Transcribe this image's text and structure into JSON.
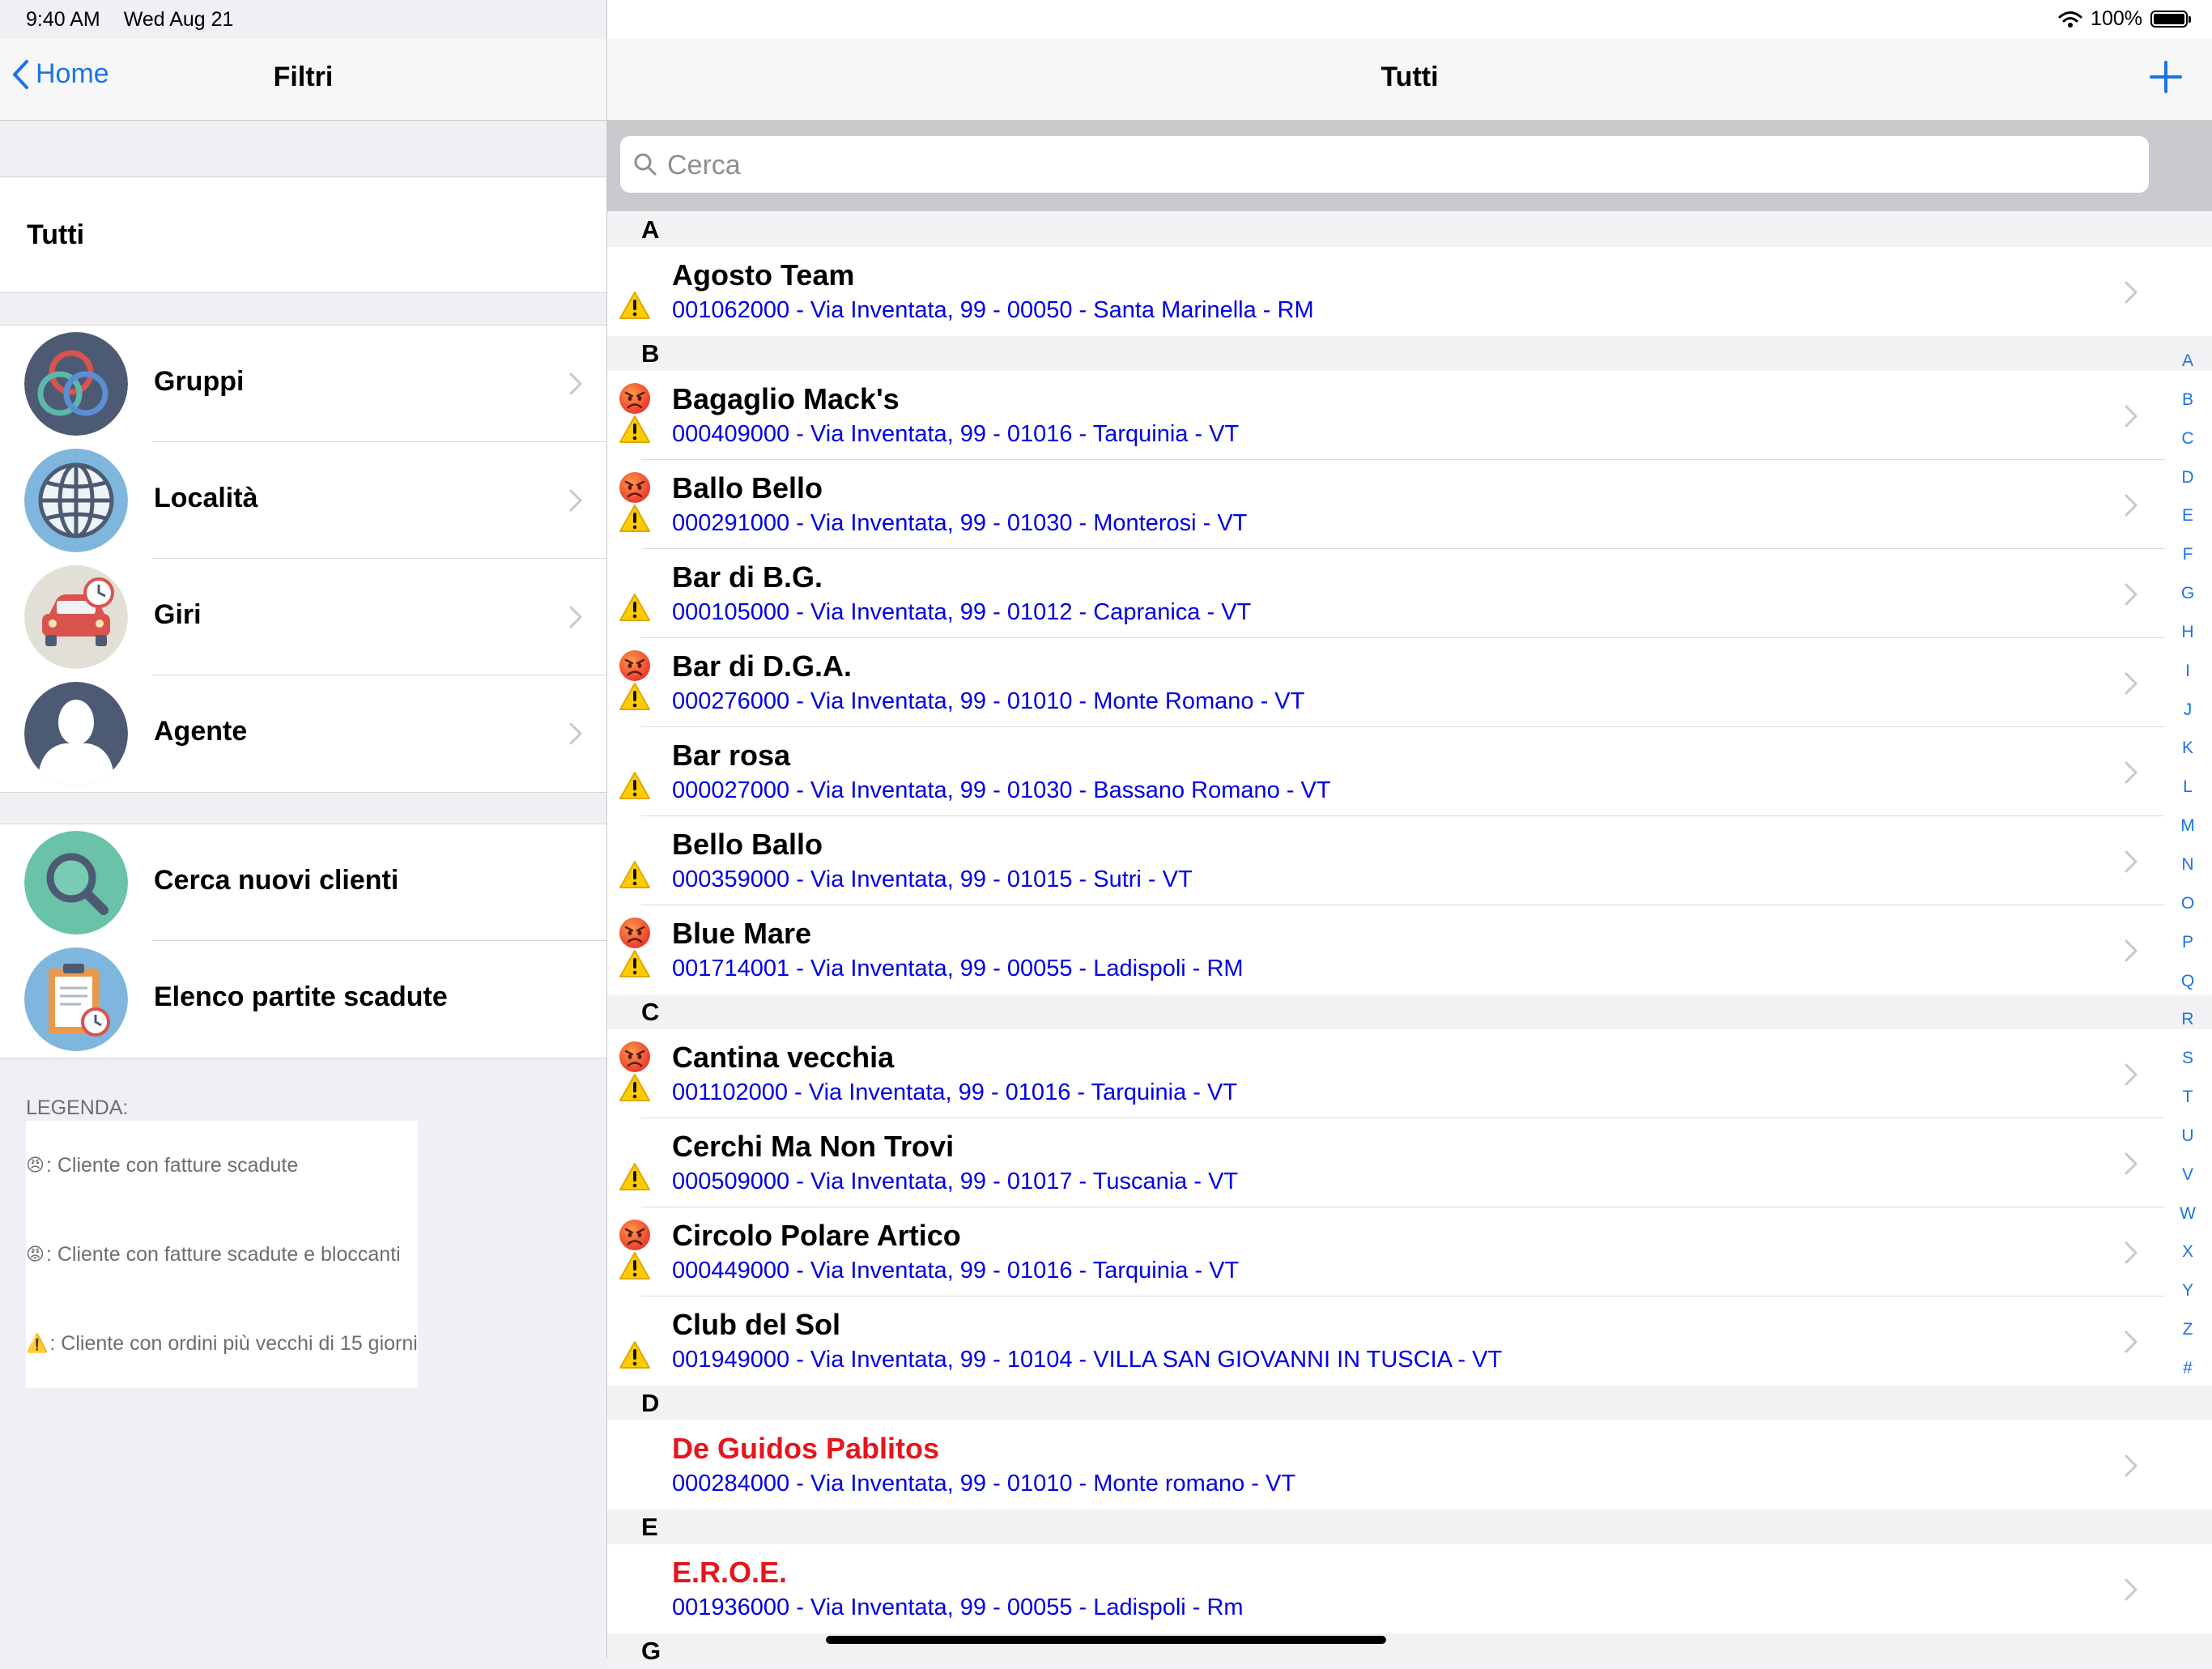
{
  "status_bar": {
    "time": "9:40 AM",
    "date": "Wed Aug 21",
    "battery": "100%"
  },
  "left": {
    "back_label": "Home",
    "title": "Filtri",
    "all_label": "Tutti",
    "filters": [
      {
        "label": "Gruppi",
        "icon": "groups-icon"
      },
      {
        "label": "Località",
        "icon": "globe-icon"
      },
      {
        "label": "Giri",
        "icon": "car-clock-icon"
      },
      {
        "label": "Agente",
        "icon": "person-icon"
      }
    ],
    "tools": [
      {
        "label": "Cerca nuovi clienti",
        "icon": "magnifier-icon"
      },
      {
        "label": "Elenco partite scadute",
        "icon": "clipboard-icon"
      }
    ],
    "legend": {
      "title": "LEGENDA:",
      "items": [
        {
          "icon": "😠",
          "text": ": Cliente con fatture scadute"
        },
        {
          "icon": "😡",
          "text": ": Cliente con fatture scadute e bloccanti"
        },
        {
          "icon": "⚠️",
          "text": ": Cliente con ordini più vecchi di 15 giorni"
        }
      ]
    }
  },
  "right": {
    "title": "Tutti",
    "search_placeholder": "Cerca",
    "sections": [
      {
        "letter": "A",
        "rows": [
          {
            "name": "Agosto Team",
            "address": "001062000 - Via Inventata, 99 - 00050 - Santa Marinella - RM",
            "angry": false,
            "warning": true,
            "red": false
          }
        ]
      },
      {
        "letter": "B",
        "rows": [
          {
            "name": "Bagaglio Mack's",
            "address": "000409000 - Via Inventata, 99 - 01016 - Tarquinia - VT",
            "angry": true,
            "warning": true,
            "red": false
          },
          {
            "name": "Ballo Bello",
            "address": "000291000 - Via Inventata, 99 - 01030 - Monterosi - VT",
            "angry": true,
            "warning": true,
            "red": false
          },
          {
            "name": "Bar di B.G.",
            "address": "000105000 - Via Inventata, 99 - 01012 - Capranica - VT",
            "angry": false,
            "warning": true,
            "red": false
          },
          {
            "name": "Bar di D.G.A.",
            "address": "000276000 - Via Inventata, 99 - 01010 - Monte Romano - VT",
            "angry": true,
            "warning": true,
            "red": false
          },
          {
            "name": "Bar rosa",
            "address": "000027000 - Via Inventata, 99 - 01030 - Bassano Romano - VT",
            "angry": false,
            "warning": true,
            "red": false
          },
          {
            "name": "Bello Ballo",
            "address": "000359000 - Via Inventata, 99 - 01015 - Sutri - VT",
            "angry": false,
            "warning": true,
            "red": false
          },
          {
            "name": "Blue Mare",
            "address": "001714001 - Via Inventata, 99 - 00055 - Ladispoli - RM",
            "angry": true,
            "warning": true,
            "red": false
          }
        ]
      },
      {
        "letter": "C",
        "rows": [
          {
            "name": "Cantina vecchia",
            "address": "001102000 - Via Inventata, 99 - 01016 - Tarquinia - VT",
            "angry": true,
            "warning": true,
            "red": false
          },
          {
            "name": "Cerchi Ma Non Trovi",
            "address": "000509000 - Via Inventata, 99 - 01017 - Tuscania - VT",
            "angry": false,
            "warning": true,
            "red": false
          },
          {
            "name": "Circolo Polare Artico",
            "address": "000449000 - Via Inventata, 99 - 01016 - Tarquinia - VT",
            "angry": true,
            "warning": true,
            "red": false
          },
          {
            "name": "Club del Sol",
            "address": "001949000 - Via Inventata, 99 - 10104 - VILLA SAN GIOVANNI IN TUSCIA - VT",
            "angry": false,
            "warning": true,
            "red": false
          }
        ]
      },
      {
        "letter": "D",
        "rows": [
          {
            "name": "De Guidos Pablitos",
            "address": "000284000 - Via Inventata, 99 - 01010 - Monte romano - VT",
            "angry": false,
            "warning": false,
            "red": true
          }
        ]
      },
      {
        "letter": "E",
        "rows": [
          {
            "name": "E.R.O.E.",
            "address": "001936000 - Via Inventata, 99 - 00055 - Ladispoli - Rm",
            "angry": false,
            "warning": false,
            "red": true
          }
        ]
      },
      {
        "letter": "G",
        "rows": []
      }
    ],
    "index_letters": [
      "A",
      "B",
      "C",
      "D",
      "E",
      "F",
      "G",
      "H",
      "I",
      "J",
      "K",
      "L",
      "M",
      "N",
      "O",
      "P",
      "Q",
      "R",
      "S",
      "T",
      "U",
      "V",
      "W",
      "X",
      "Y",
      "Z",
      "#"
    ]
  },
  "colors": {
    "tint": "#1a73e8",
    "address": "#0000e6",
    "blocked_name": "#e4161b"
  }
}
